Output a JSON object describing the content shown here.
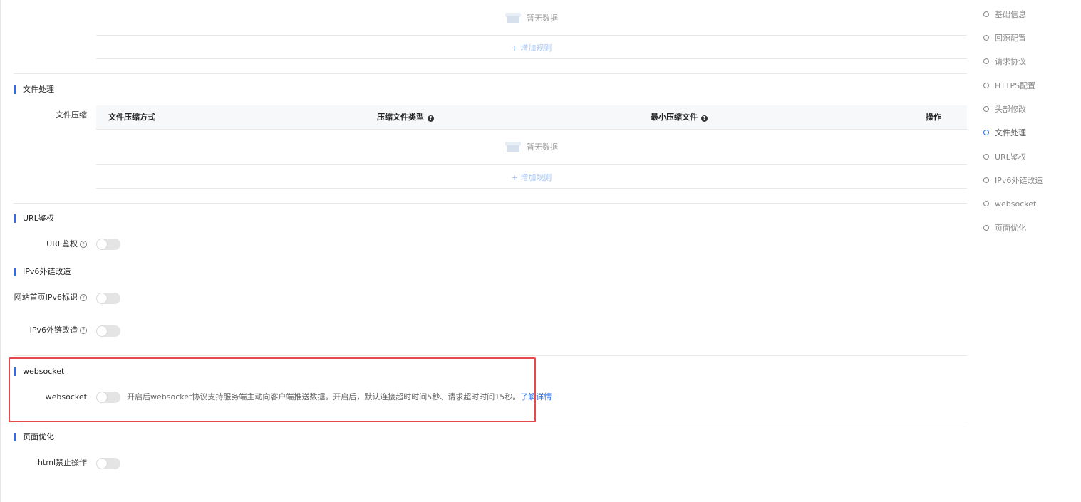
{
  "empty_text": "暂无数据",
  "add_rule": "+ 增加规则",
  "file_processing": {
    "section_title": "文件处理",
    "compression_label": "文件压缩",
    "columns": [
      "文件压缩方式",
      "压缩文件类型",
      "最小压缩文件",
      "操作"
    ]
  },
  "url_auth": {
    "section_title": "URL鉴权",
    "label": "URL鉴权"
  },
  "ipv6": {
    "section_title": "IPv6外链改造",
    "homepage_label": "网站首页IPv6标识",
    "link_label": "IPv6外链改造"
  },
  "websocket": {
    "section_title": "websocket",
    "label": "websocket",
    "description": "开启后websocket协议支持服务端主动向客户端推送数据。开启后，默认连接超时时间5秒、请求超时时间15秒。",
    "learn_more": "了解详情"
  },
  "page_optimization": {
    "section_title": "页面优化",
    "label": "html禁止操作"
  },
  "anchor_nav": {
    "items": [
      "基础信息",
      "回源配置",
      "请求协议",
      "HTTPS配置",
      "头部修改",
      "文件处理",
      "URL鉴权",
      "IPv6外链改造",
      "websocket",
      "页面优化"
    ],
    "active": "文件处理"
  },
  "colors": {
    "accent": "#2f6ce5",
    "highlight_border": "#e5484d",
    "toggle_off": "#e4e4e4"
  }
}
